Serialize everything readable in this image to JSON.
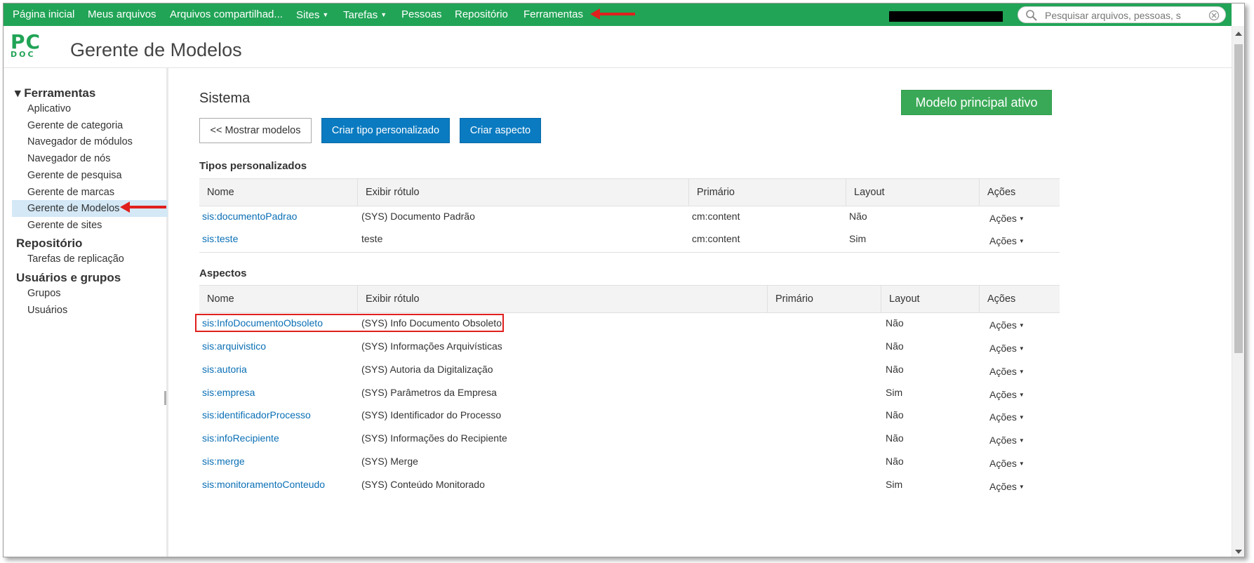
{
  "topnav": {
    "items": [
      {
        "label": "Página inicial"
      },
      {
        "label": "Meus arquivos"
      },
      {
        "label": "Arquivos compartilhad..."
      },
      {
        "label": "Sites",
        "dropdown": true
      },
      {
        "label": "Tarefas",
        "dropdown": true
      },
      {
        "label": "Pessoas"
      },
      {
        "label": "Repositório"
      },
      {
        "label": "Ferramentas"
      }
    ],
    "search_placeholder": "Pesquisar arquivos, pessoas, s"
  },
  "header": {
    "logo_top": "PC",
    "logo_bottom": "DOC",
    "title": "Gerente de Modelos"
  },
  "sidebar": {
    "sections": [
      {
        "title": "▾ Ferramentas",
        "items": [
          "Aplicativo",
          "Gerente de categoria",
          "Navegador de módulos",
          "Navegador de nós",
          "Gerente de pesquisa",
          "Gerente de marcas",
          "Gerente de Modelos",
          "Gerente de sites"
        ]
      },
      {
        "title": "Repositório",
        "items": [
          "Tarefas de replicação"
        ]
      },
      {
        "title": "Usuários e grupos",
        "items": [
          "Grupos",
          "Usuários"
        ]
      }
    ],
    "selected": "Gerente de Modelos"
  },
  "main": {
    "title": "Sistema",
    "show_models_label": "<< Mostrar modelos",
    "create_type_label": "Criar tipo personalizado",
    "create_aspect_label": "Criar aspecto",
    "active_model_label": "Modelo principal ativo",
    "custom_types": {
      "heading": "Tipos personalizados",
      "columns": [
        "Nome",
        "Exibir rótulo",
        "Primário",
        "Layout",
        "Ações"
      ],
      "rows": [
        {
          "name": "sis:documentoPadrao",
          "label": "(SYS) Documento Padrão",
          "primary": "cm:content",
          "layout": "Não",
          "actions": "Ações"
        },
        {
          "name": "sis:teste",
          "label": "teste",
          "primary": "cm:content",
          "layout": "Sim",
          "actions": "Ações"
        }
      ]
    },
    "aspects": {
      "heading": "Aspectos",
      "columns": [
        "Nome",
        "Exibir rótulo",
        "Primário",
        "Layout",
        "Ações"
      ],
      "rows": [
        {
          "name": "sis:InfoDocumentoObsoleto",
          "label": "(SYS) Info Documento Obsoleto",
          "primary": "",
          "layout": "Não",
          "actions": "Ações"
        },
        {
          "name": "sis:arquivistico",
          "label": "(SYS) Informações Arquivísticas",
          "primary": "",
          "layout": "Não",
          "actions": "Ações"
        },
        {
          "name": "sis:autoria",
          "label": "(SYS) Autoria da Digitalização",
          "primary": "",
          "layout": "Não",
          "actions": "Ações"
        },
        {
          "name": "sis:empresa",
          "label": "(SYS) Parâmetros da Empresa",
          "primary": "",
          "layout": "Sim",
          "actions": "Ações"
        },
        {
          "name": "sis:identificadorProcesso",
          "label": "(SYS) Identificador do Processo",
          "primary": "",
          "layout": "Não",
          "actions": "Ações"
        },
        {
          "name": "sis:infoRecipiente",
          "label": "(SYS) Informações do Recipiente",
          "primary": "",
          "layout": "Não",
          "actions": "Ações"
        },
        {
          "name": "sis:merge",
          "label": "(SYS) Merge",
          "primary": "",
          "layout": "Não",
          "actions": "Ações"
        },
        {
          "name": "sis:monitoramentoConteudo",
          "label": "(SYS) Conteúdo Monitorado",
          "primary": "",
          "layout": "Sim",
          "actions": "Ações"
        }
      ]
    }
  },
  "colors": {
    "nav_green": "#21a456",
    "primary_blue": "#0a7bc1",
    "active_green": "#3aa957",
    "link_blue": "#0a6fb5",
    "annotation_red": "#e0201d"
  }
}
